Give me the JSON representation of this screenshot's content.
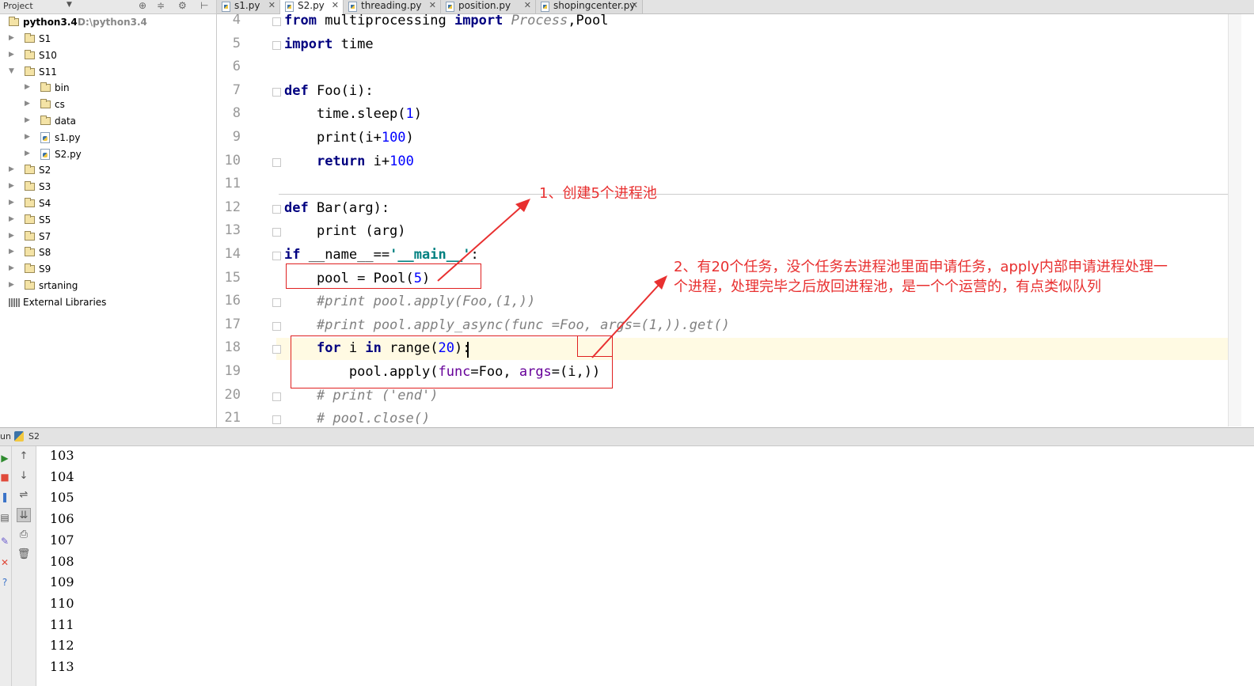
{
  "project": {
    "title": "Project",
    "root": {
      "name": "python3.4",
      "path": "D:\\python3.4"
    },
    "items": [
      {
        "label": "S1",
        "type": "folder",
        "depth": 1,
        "expanded": false
      },
      {
        "label": "S10",
        "type": "folder",
        "depth": 1,
        "expanded": false
      },
      {
        "label": "S11",
        "type": "folder",
        "depth": 1,
        "expanded": true
      },
      {
        "label": "bin",
        "type": "folder",
        "depth": 2,
        "expanded": false
      },
      {
        "label": "cs",
        "type": "folder",
        "depth": 2,
        "expanded": false
      },
      {
        "label": "data",
        "type": "folder",
        "depth": 2,
        "expanded": false
      },
      {
        "label": "s1.py",
        "type": "pyfile",
        "depth": 2,
        "expanded": false
      },
      {
        "label": "S2.py",
        "type": "pyfile",
        "depth": 2,
        "expanded": false
      },
      {
        "label": "S2",
        "type": "folder",
        "depth": 1,
        "expanded": false
      },
      {
        "label": "S3",
        "type": "folder",
        "depth": 1,
        "expanded": false
      },
      {
        "label": "S4",
        "type": "folder",
        "depth": 1,
        "expanded": false
      },
      {
        "label": "S5",
        "type": "folder",
        "depth": 1,
        "expanded": false
      },
      {
        "label": "S7",
        "type": "folder",
        "depth": 1,
        "expanded": false
      },
      {
        "label": "S8",
        "type": "folder",
        "depth": 1,
        "expanded": false
      },
      {
        "label": "S9",
        "type": "folder",
        "depth": 1,
        "expanded": false
      },
      {
        "label": "srtaning",
        "type": "folder",
        "depth": 1,
        "expanded": false
      }
    ],
    "external_libraries": "External Libraries"
  },
  "tabs": [
    {
      "label": "s1.py",
      "active": false
    },
    {
      "label": "S2.py",
      "active": true
    },
    {
      "label": "threading.py",
      "active": false
    },
    {
      "label": "position.py",
      "active": false
    },
    {
      "label": "shopingcenter.py",
      "active": false
    }
  ],
  "editor": {
    "line_numbers": [
      "4",
      "5",
      "6",
      "7",
      "8",
      "9",
      "10",
      "11",
      "12",
      "13",
      "14",
      "15",
      "16",
      "17",
      "18",
      "19",
      "20",
      "21"
    ],
    "lines": [
      [
        {
          "t": "from",
          "c": "kw"
        },
        {
          "t": " multiprocessing ",
          "c": ""
        },
        {
          "t": "import",
          "c": "kw"
        },
        {
          "t": " Process",
          "c": "cmt"
        },
        {
          "t": ",Pool",
          "c": ""
        }
      ],
      [
        {
          "t": "import",
          "c": "kw"
        },
        {
          "t": " time",
          "c": ""
        }
      ],
      [],
      [
        {
          "t": "def",
          "c": "kw"
        },
        {
          "t": " Foo(i):",
          "c": ""
        }
      ],
      [
        {
          "t": "    time.sleep(",
          "c": ""
        },
        {
          "t": "1",
          "c": "num"
        },
        {
          "t": ")",
          "c": ""
        }
      ],
      [
        {
          "t": "    print(i+",
          "c": ""
        },
        {
          "t": "100",
          "c": "num"
        },
        {
          "t": ")",
          "c": ""
        }
      ],
      [
        {
          "t": "    ",
          "c": ""
        },
        {
          "t": "return",
          "c": "kw"
        },
        {
          "t": " i+",
          "c": ""
        },
        {
          "t": "100",
          "c": "num"
        }
      ],
      [],
      [
        {
          "t": "def",
          "c": "kw"
        },
        {
          "t": " Bar(arg):",
          "c": ""
        }
      ],
      [
        {
          "t": "    print (arg)",
          "c": ""
        }
      ],
      [
        {
          "t": "if",
          "c": "kw"
        },
        {
          "t": " __name__==",
          "c": ""
        },
        {
          "t": "'__main__'",
          "c": "str"
        },
        {
          "t": ":",
          "c": ""
        }
      ],
      [
        {
          "t": "    pool = Pool(",
          "c": ""
        },
        {
          "t": "5",
          "c": "num"
        },
        {
          "t": ")",
          "c": ""
        }
      ],
      [
        {
          "t": "    #print pool.apply(Foo,(1,))",
          "c": "cmt"
        }
      ],
      [
        {
          "t": "    #print pool.apply_async(func =Foo, args=(1,)).get()",
          "c": "cmt"
        }
      ],
      [
        {
          "t": "    ",
          "c": ""
        },
        {
          "t": "for",
          "c": "kw"
        },
        {
          "t": " i ",
          "c": ""
        },
        {
          "t": "in",
          "c": "kw"
        },
        {
          "t": " range(",
          "c": ""
        },
        {
          "t": "20",
          "c": "num"
        },
        {
          "t": "):",
          "c": ""
        }
      ],
      [
        {
          "t": "        pool.apply(",
          "c": ""
        },
        {
          "t": "func",
          "c": "kwarg"
        },
        {
          "t": "=Foo, ",
          "c": ""
        },
        {
          "t": "args",
          "c": "kwarg"
        },
        {
          "t": "=(i,))",
          "c": ""
        }
      ],
      [
        {
          "t": "    # print ('end')",
          "c": "cmt"
        }
      ],
      [
        {
          "t": "    # pool.close()",
          "c": "cmt"
        }
      ]
    ]
  },
  "annotations": {
    "note1": "1、创建5个进程池",
    "note2_line1": "2、有20个任务，没个任务去进程池里面申请任务，apply内部申请进程处理一",
    "note2_line2": "个进程，处理完毕之后放回进程池，是一个个运营的，有点类似队列",
    "color": "#e83030"
  },
  "run": {
    "label": "un",
    "config": "S2",
    "output": [
      "103",
      "104",
      "105",
      "106",
      "107",
      "108",
      "109",
      "110",
      "111",
      "112",
      "113"
    ]
  }
}
